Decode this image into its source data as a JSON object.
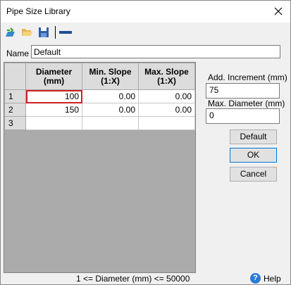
{
  "window": {
    "title": "Pipe Size Library"
  },
  "toolbar": {
    "icons": [
      "new-icon",
      "open-folder-icon",
      "save-icon",
      "minus-icon"
    ]
  },
  "name": {
    "label": "Name",
    "value": "Default"
  },
  "table": {
    "headers": [
      "Diameter (mm)",
      "Min. Slope (1:X)",
      "Max. Slope (1:X)"
    ],
    "header_lines": [
      [
        "Diameter",
        "(mm)"
      ],
      [
        "Min. Slope",
        "(1:X)"
      ],
      [
        "Max. Slope",
        "(1:X)"
      ]
    ],
    "rows": [
      {
        "num": "1",
        "cells": [
          "100",
          "0.00",
          "0.00"
        ]
      },
      {
        "num": "2",
        "cells": [
          "150",
          "0.00",
          "0.00"
        ]
      },
      {
        "num": "3",
        "cells": [
          "",
          "",
          ""
        ]
      }
    ]
  },
  "side": {
    "increment_label": "Add. Increment (mm)",
    "increment_value": "75",
    "maxdiam_label": "Max. Diameter (mm)",
    "maxdiam_value": "0"
  },
  "buttons": {
    "default": "Default",
    "ok": "OK",
    "cancel": "Cancel"
  },
  "status": {
    "text": "1 <= Diameter (mm) <= 50000",
    "help": "Help"
  },
  "colors": {
    "selection_border": "#cc2020",
    "accent": "#0078d7"
  }
}
